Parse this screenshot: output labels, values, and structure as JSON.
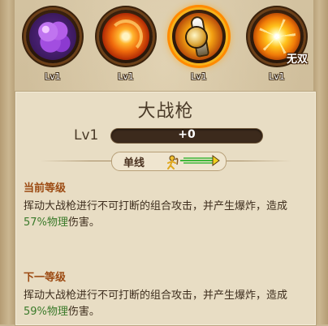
{
  "skills": [
    {
      "name": "purple-skill",
      "level": "Lv1",
      "badge": ""
    },
    {
      "name": "fire-skill",
      "level": "Lv1",
      "badge": ""
    },
    {
      "name": "spear-skill",
      "level": "Lv1",
      "badge": ""
    },
    {
      "name": "burst-skill",
      "level": "Lv1",
      "badge": "无双"
    }
  ],
  "detail": {
    "title": "大战枪",
    "level_label": "Lv1",
    "exp_text": "+0",
    "exp_progress": 0,
    "target_type": "单线",
    "icon": "archer-arrow-icon"
  },
  "current": {
    "heading": "当前等级",
    "desc_pre": "挥动大战枪进行不可打断的组合攻击，并产生爆炸，造成",
    "percent": "57%",
    "dmg_type": "物理",
    "desc_post": "伤害。"
  },
  "next": {
    "heading": "下一等级",
    "desc_pre": "挥动大战枪进行不可打断的组合攻击，并产生爆炸，造成",
    "percent": "59%",
    "dmg_type": "物理",
    "desc_post": "伤害。"
  },
  "colors": {
    "heading": "#9c4a12",
    "highlight": "#3a7a2a",
    "selected_ring": "#f5b21b"
  }
}
